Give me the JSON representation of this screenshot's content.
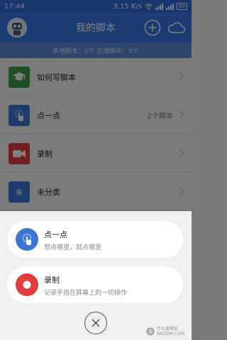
{
  "status": {
    "time": "17:44",
    "speed": "3.15 K/s",
    "battery": "60"
  },
  "header": {
    "title": "我的脚本"
  },
  "info": {
    "text": "本地脚本：0个 云端脚本：0个"
  },
  "list": {
    "items": [
      {
        "label": "如何写脚本",
        "count": ""
      },
      {
        "label": "点一点",
        "count": "2个脚本"
      },
      {
        "label": "录制",
        "count": ""
      },
      {
        "label": "未分类",
        "count": "",
        "icon_char": "未"
      }
    ]
  },
  "sheet": {
    "cards": [
      {
        "title": "点一点",
        "subtitle": "想点哪里，就点哪里"
      },
      {
        "title": "录制",
        "subtitle": "记录手指在屏幕上的一切操作"
      }
    ]
  },
  "watermark": {
    "line1": "什么值得买",
    "line2": "SMZDM.COM"
  },
  "colors": {
    "primary": "#3478e5",
    "green": "#3aa14a",
    "red": "#e23c3c",
    "blue": "#3b78d6"
  }
}
